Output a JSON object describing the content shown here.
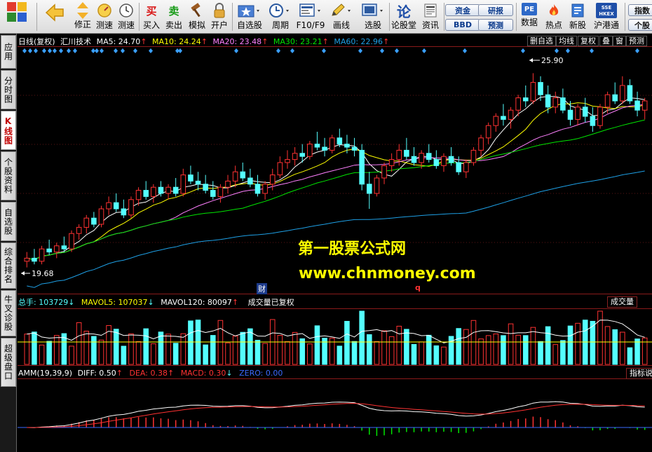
{
  "toolbar": {
    "buttons": [
      {
        "label": "修正",
        "icon": "arrow-up-down-icon"
      },
      {
        "label": "测速",
        "icon": "speedometer-icon"
      },
      {
        "label": "买入",
        "icon": "buy-icon",
        "glyph": "买"
      },
      {
        "label": "卖出",
        "icon": "sell-icon",
        "glyph": "卖"
      },
      {
        "label": "模拟",
        "icon": "hammer-icon"
      },
      {
        "label": "开户",
        "icon": "lock-icon"
      },
      {
        "label": "自选股",
        "icon": "star-folder-icon"
      },
      {
        "label": "周期",
        "icon": "clock-icon"
      },
      {
        "label": "F10/F9",
        "icon": "f10-icon"
      },
      {
        "label": "画线",
        "icon": "pencil-icon"
      },
      {
        "label": "选股",
        "icon": "screen-icon"
      },
      {
        "label": "论股堂",
        "icon": "forum-icon",
        "glyph": "论"
      },
      {
        "label": "资讯",
        "icon": "news-icon"
      },
      {
        "label": "数据",
        "icon": "pe-icon",
        "glyph": "PE"
      },
      {
        "label": "热点",
        "icon": "fire-icon"
      },
      {
        "label": "新股",
        "icon": "new-stock-icon"
      },
      {
        "label": "沪港通",
        "icon": "sse-hkex-icon",
        "glyph": "SSE HKEX"
      }
    ],
    "mini_buttons": {
      "zijin": "资金",
      "yanbao": "研报",
      "bbd": "BBD",
      "yuce": "预测",
      "zhishu": "指数",
      "gegu": "个股"
    }
  },
  "left_tabs": [
    "应用",
    "分时图",
    "K线图",
    "个股资料",
    "自选股",
    "综合排名",
    "牛叉诊股",
    "超级盘口"
  ],
  "main_header": {
    "period": "日线(复权)",
    "stock": "汇川技术",
    "ma5": "MA5: 24.70",
    "ma10": "MA10: 24.24",
    "ma20": "MA20: 23.48",
    "ma30": "MA30: 23.21",
    "ma60": "MA60: 22.96"
  },
  "right_buttons": [
    "删自选",
    "均线",
    "复权",
    "叠",
    "窗",
    "预测"
  ],
  "annotations": {
    "high": "25.90",
    "low": "19.68",
    "cai": "财",
    "q": "q"
  },
  "volume_header": {
    "total": "总手: 103729",
    "mavol5": "MAVOL5: 107037",
    "mavol120": "MAVOL120: 80097",
    "note": "成交量已复权",
    "tag": "成交量"
  },
  "macd_header": {
    "name": "AMM(19,39,9)",
    "diff": "DIFF: 0.50",
    "dea": "DEA: 0.38",
    "macd": "MACD: 0.30",
    "zero": "ZERO: 0.00",
    "tag": "指标说"
  },
  "watermark": {
    "cn": "第一股票公式网",
    "url": "www.chnmoney.com"
  },
  "colors": {
    "up": "#ff3232",
    "down": "#54ffff",
    "ma5": "#ffffff",
    "ma10": "#ffff00",
    "ma20": "#ff80ff",
    "ma30": "#00e600",
    "ma60": "#1ea0e6",
    "grid": "#8a1a1a",
    "diamond": "#3aa0ff"
  },
  "chart_data": {
    "type": "candlestick",
    "title": "汇川技术 日线(复权)",
    "price_ylim": [
      19,
      26.5
    ],
    "low_label": 19.68,
    "high_label": 25.9,
    "candles": [
      [
        19.8,
        20.1,
        19.6,
        19.9
      ],
      [
        19.9,
        20.2,
        19.7,
        19.8
      ],
      [
        19.8,
        20.3,
        19.7,
        20.2
      ],
      [
        20.2,
        20.5,
        20.0,
        20.1
      ],
      [
        20.1,
        20.4,
        19.9,
        20.3
      ],
      [
        20.3,
        20.6,
        20.1,
        20.2
      ],
      [
        20.2,
        20.8,
        20.1,
        20.7
      ],
      [
        20.7,
        21.0,
        20.5,
        20.9
      ],
      [
        20.9,
        21.3,
        20.7,
        21.2
      ],
      [
        21.2,
        21.4,
        20.9,
        21.0
      ],
      [
        21.0,
        21.6,
        20.9,
        21.5
      ],
      [
        21.5,
        21.9,
        21.3,
        21.7
      ],
      [
        21.7,
        22.0,
        21.4,
        21.5
      ],
      [
        21.5,
        21.8,
        21.2,
        21.3
      ],
      [
        21.3,
        21.9,
        21.2,
        21.8
      ],
      [
        21.8,
        22.2,
        21.6,
        22.1
      ],
      [
        22.1,
        22.4,
        21.8,
        21.9
      ],
      [
        21.9,
        22.3,
        21.7,
        22.2
      ],
      [
        22.2,
        22.4,
        21.9,
        22.0
      ],
      [
        22.0,
        22.3,
        21.8,
        22.2
      ],
      [
        22.2,
        22.5,
        21.9,
        22.0
      ],
      [
        22.0,
        22.8,
        21.9,
        22.6
      ],
      [
        22.6,
        22.9,
        22.3,
        22.4
      ],
      [
        22.4,
        22.7,
        22.1,
        22.3
      ],
      [
        22.3,
        22.6,
        22.0,
        22.1
      ],
      [
        22.1,
        22.4,
        21.8,
        21.9
      ],
      [
        21.9,
        22.3,
        21.7,
        22.2
      ],
      [
        22.2,
        22.6,
        22.0,
        22.4
      ],
      [
        22.4,
        22.9,
        22.2,
        22.7
      ],
      [
        22.7,
        23.0,
        22.4,
        22.5
      ],
      [
        22.5,
        22.8,
        22.2,
        22.3
      ],
      [
        22.3,
        22.6,
        21.9,
        22.0
      ],
      [
        22.0,
        22.4,
        21.8,
        22.3
      ],
      [
        22.3,
        22.8,
        22.1,
        22.6
      ],
      [
        22.6,
        23.2,
        22.5,
        23.0
      ],
      [
        23.0,
        23.4,
        22.8,
        23.1
      ],
      [
        23.1,
        23.5,
        22.9,
        23.3
      ],
      [
        23.3,
        23.6,
        23.0,
        23.2
      ],
      [
        23.2,
        23.7,
        23.1,
        23.6
      ],
      [
        23.6,
        24.0,
        23.4,
        23.5
      ],
      [
        23.5,
        23.8,
        23.2,
        23.4
      ],
      [
        23.4,
        23.9,
        23.3,
        23.8
      ],
      [
        23.8,
        24.1,
        23.5,
        23.6
      ],
      [
        23.6,
        23.9,
        23.3,
        23.5
      ],
      [
        23.5,
        23.8,
        23.2,
        23.4
      ],
      [
        23.4,
        23.6,
        22.1,
        22.3
      ],
      [
        22.3,
        22.7,
        21.5,
        22.0
      ],
      [
        22.0,
        22.6,
        21.9,
        22.5
      ],
      [
        22.5,
        23.0,
        22.3,
        22.9
      ],
      [
        22.9,
        23.3,
        22.7,
        23.1
      ],
      [
        23.1,
        23.6,
        22.9,
        23.4
      ],
      [
        23.4,
        23.8,
        23.1,
        23.2
      ],
      [
        23.2,
        23.5,
        22.9,
        23.0
      ],
      [
        23.0,
        23.4,
        22.8,
        23.3
      ],
      [
        23.3,
        23.6,
        23.0,
        23.1
      ],
      [
        23.1,
        23.4,
        22.8,
        22.9
      ],
      [
        22.9,
        23.3,
        22.7,
        23.2
      ],
      [
        23.2,
        23.5,
        22.9,
        23.0
      ],
      [
        23.0,
        23.2,
        22.6,
        22.7
      ],
      [
        22.7,
        23.1,
        22.5,
        23.0
      ],
      [
        23.0,
        23.5,
        22.9,
        23.4
      ],
      [
        23.4,
        23.9,
        23.2,
        23.8
      ],
      [
        23.8,
        24.3,
        23.6,
        24.2
      ],
      [
        24.2,
        24.6,
        24.0,
        24.5
      ],
      [
        24.5,
        24.9,
        24.2,
        24.4
      ],
      [
        24.4,
        24.8,
        24.1,
        24.7
      ],
      [
        24.7,
        25.2,
        24.5,
        25.1
      ],
      [
        25.1,
        25.5,
        24.8,
        25.0
      ],
      [
        25.0,
        25.9,
        24.9,
        25.6
      ],
      [
        25.6,
        25.8,
        25.0,
        25.2
      ],
      [
        25.2,
        25.5,
        24.6,
        24.8
      ],
      [
        24.8,
        25.3,
        24.6,
        25.1
      ],
      [
        25.1,
        25.4,
        24.6,
        24.7
      ],
      [
        24.7,
        25.0,
        24.2,
        24.4
      ],
      [
        24.4,
        24.9,
        24.2,
        24.8
      ],
      [
        24.8,
        25.1,
        24.3,
        24.5
      ],
      [
        24.5,
        24.8,
        24.0,
        24.2
      ],
      [
        24.2,
        24.9,
        24.1,
        24.8
      ],
      [
        24.8,
        25.3,
        24.6,
        25.2
      ],
      [
        25.2,
        25.6,
        24.9,
        25.0
      ],
      [
        25.0,
        25.8,
        24.9,
        25.5
      ],
      [
        25.5,
        25.7,
        24.9,
        25.0
      ],
      [
        25.0,
        25.3,
        24.5,
        24.7
      ],
      [
        24.7,
        25.1,
        24.4,
        25.0
      ]
    ]
  }
}
